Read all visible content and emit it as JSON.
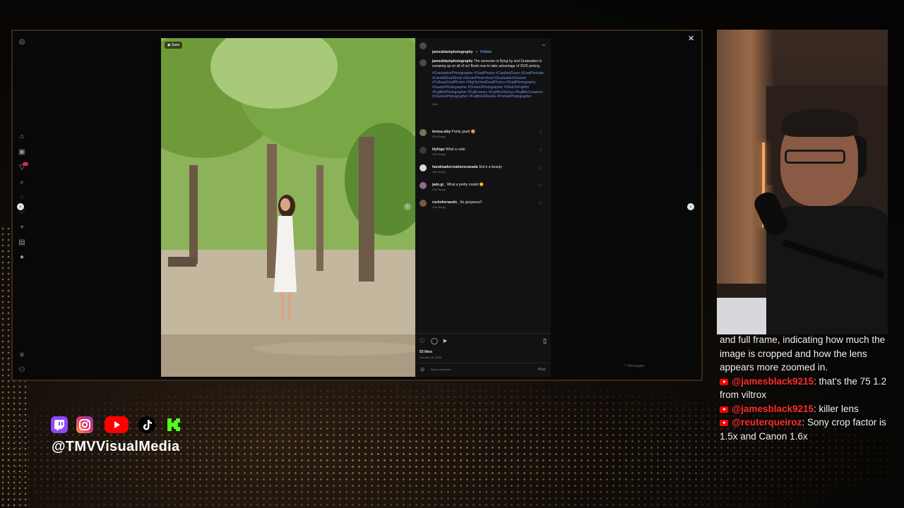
{
  "post": {
    "author": "jamesblackphotography",
    "separator": "•",
    "follow": "Follow",
    "more": "•••",
    "save_chip": "Save",
    "caption_author": "jamesblackphotography",
    "caption_text": "The semester is flying by and Graduation is creeping up on all of us! Book now to take advantage of 2025 pricing.",
    "hashtags": "#GraduationPhotographer #GradPhotos #CapAndGown #GradPortraits #CandidGradShots #SeniorPhotoshoot #GraduationSession #CollegeGradPhotos #HighSchoolGradPhotos #GradPhotography #GuelphPhotographer #OntarioPhotographer #ShotOnFujifilm #FujifilmPhotographer #FujiFrames #FujifilmXSeries #FujifilmCreatives #XSeriesPhotographer #FujifilmXWeekly #PortraitPhotographer",
    "caption_age": "22w",
    "likes": "53 likes",
    "date": "October 28, 2025",
    "add_comment_placeholder": "Add a comment...",
    "post_button": "Post",
    "messages": "Messages"
  },
  "comments": [
    {
      "user": "teresa.siby",
      "text": "Pretty grad! 🥰",
      "age": "22w",
      "reply": "Reply"
    },
    {
      "user": "klyfoge",
      "text": "What a cutie",
      "age": "21w",
      "reply": "Reply"
    },
    {
      "user": "handmadecreationscanada",
      "text": "She's a beauty",
      "age": "22w",
      "reply": "Reply"
    },
    {
      "user": "jade.gr_",
      "text": "What a pretty model 😊",
      "age": "22w",
      "reply": "Reply"
    },
    {
      "user": "rochefernando_",
      "text": "So gorgeous!!",
      "age": "22w",
      "reply": "Reply"
    }
  ],
  "chat": {
    "lines": [
      {
        "user": "",
        "text": "and full frame, indicating how much the image is cropped and how the lens appears more zoomed in."
      },
      {
        "user": "@jamesblack9215",
        "text": ": that's the 75 1.2 from viltrox"
      },
      {
        "user": "@jamesblack9215",
        "text": ": killer lens"
      },
      {
        "user": "@reuterqueiroz",
        "text": ": Sony crop factor is 1.5x and Canon 1.6x"
      }
    ]
  },
  "overlay": {
    "handle": "@TMVVisualMedia",
    "socials": [
      "twitch-icon",
      "instagram-icon",
      "youtube-icon",
      "tiktok-icon",
      "kick-icon"
    ]
  },
  "colors": {
    "accent_blue": "#6f8ff7",
    "chat_user": "#ff2d2d",
    "twitch": "#9146ff",
    "youtube": "#ff0000",
    "kick": "#53fc18"
  }
}
